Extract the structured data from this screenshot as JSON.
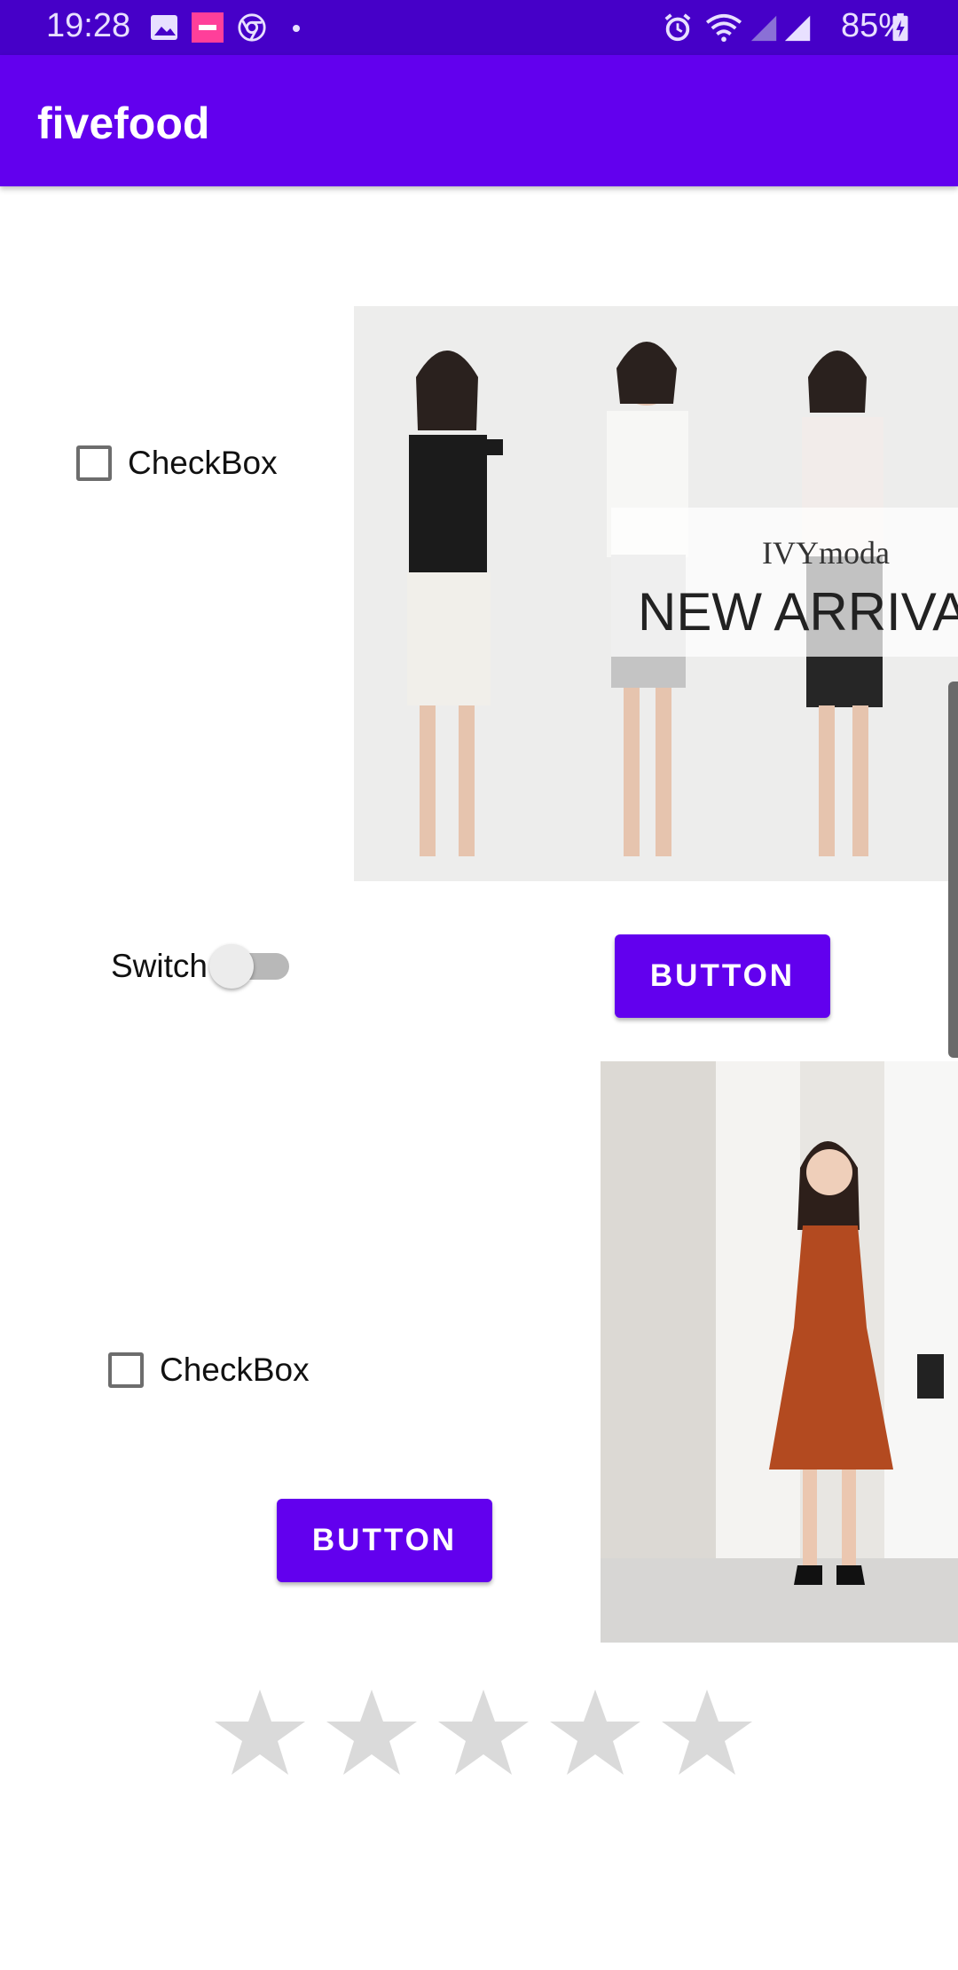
{
  "status_bar": {
    "time": "19:28",
    "battery": "85%",
    "icons": [
      "image-icon",
      "app-notification-icon",
      "chrome-icon",
      "dot-icon",
      "alarm-icon",
      "wifi-icon",
      "signal-icon",
      "battery-charging-icon"
    ]
  },
  "app_bar": {
    "title": "fivefood"
  },
  "checkbox_1": {
    "label": "CheckBox",
    "checked": false
  },
  "switch": {
    "label": "Switch",
    "on": false
  },
  "button_1": {
    "label": "BUTTON"
  },
  "banner": {
    "brand": "IVYmoda",
    "text": "NEW ARRIVA"
  },
  "checkbox_2": {
    "label": "CheckBox",
    "checked": false
  },
  "button_2": {
    "label": "BUTTON"
  },
  "rating": {
    "value": 0,
    "max": 5
  },
  "colors": {
    "primary": "#6200ee",
    "status_bar": "#4600c8"
  }
}
